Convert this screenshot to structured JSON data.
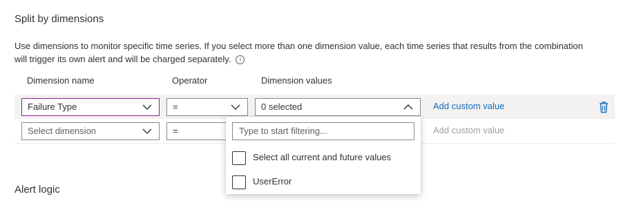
{
  "section": {
    "title": "Split by dimensions",
    "description": "Use dimensions to monitor specific time series. If you select more than one dimension value, each time series that results from the combination will trigger its own alert and will be charged separately."
  },
  "columns": {
    "name": "Dimension name",
    "operator": "Operator",
    "values": "Dimension values"
  },
  "rows": [
    {
      "dimension": "Failure Type",
      "operator": "=",
      "values": "0 selected",
      "custom_link": "Add custom value"
    },
    {
      "dimension": "Select dimension",
      "operator": "=",
      "custom_link": "Add custom value"
    }
  ],
  "dropdown": {
    "filter_placeholder": "Type to start filtering...",
    "options": [
      {
        "label": "Select all current and future values",
        "checked": false
      },
      {
        "label": "UserError",
        "checked": false
      }
    ]
  },
  "next_section": {
    "title": "Alert logic"
  },
  "colors": {
    "accent_border": "#8b1f8f",
    "link": "#0f6cbd",
    "row_highlight": "#f3f2f1",
    "delete_icon": "#0f6cbd"
  },
  "icons": [
    "info-icon",
    "chevron-down-icon",
    "chevron-up-icon",
    "trash-icon"
  ]
}
